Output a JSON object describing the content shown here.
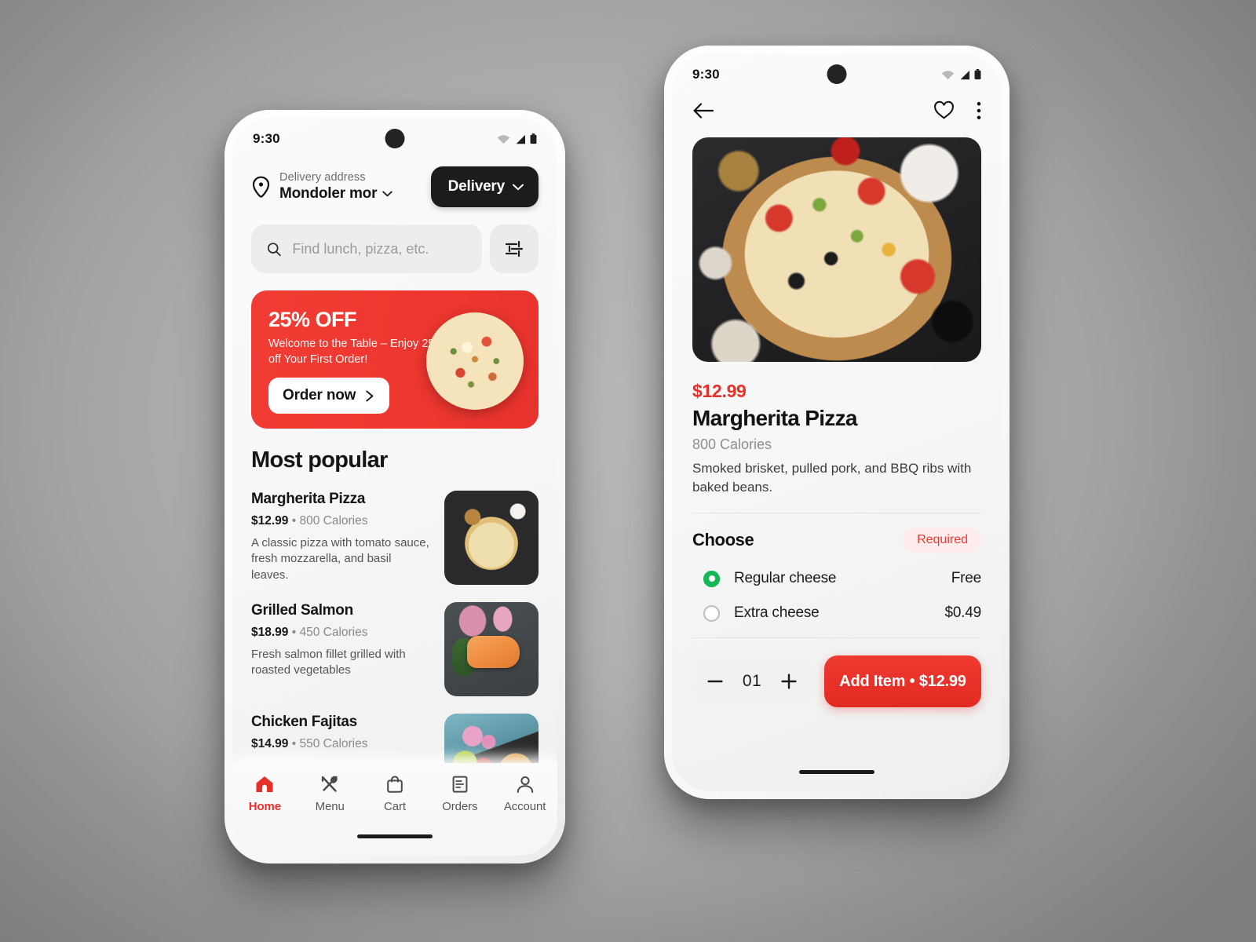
{
  "accent": {
    "red": "#E8302A",
    "red_bright": "#F03D34",
    "green": "#14B855",
    "dark": "#1C1C1C"
  },
  "status_bar": {
    "time": "9:30"
  },
  "home_screen": {
    "delivery": {
      "address_label": "Delivery address",
      "address_value": "Mondoler mor",
      "mode_button": "Delivery"
    },
    "search": {
      "placeholder": "Find lunch, pizza, etc.",
      "value": ""
    },
    "promo": {
      "headline": "25% OFF",
      "subtext": "Welcome to the Table – Enjoy 25% off Your First Order!",
      "cta": "Order now"
    },
    "section_title": "Most popular",
    "items": [
      {
        "name": "Margherita Pizza",
        "price": "$12.99",
        "calories": "800 Calories",
        "description": "A classic pizza with tomato sauce, fresh mozzarella, and basil leaves."
      },
      {
        "name": "Grilled Salmon",
        "price": "$18.99",
        "calories": "450 Calories",
        "description": "Fresh salmon fillet grilled with roasted vegetables"
      },
      {
        "name": "Chicken Fajitas",
        "price": "$14.99",
        "calories": "550 Calories",
        "description": ""
      }
    ],
    "nav": [
      {
        "label": "Home",
        "icon": "home-icon",
        "active": true
      },
      {
        "label": "Menu",
        "icon": "cutlery-icon",
        "active": false
      },
      {
        "label": "Cart",
        "icon": "bag-icon",
        "active": false
      },
      {
        "label": "Orders",
        "icon": "receipt-icon",
        "active": false
      },
      {
        "label": "Account",
        "icon": "person-icon",
        "active": false
      }
    ]
  },
  "detail_screen": {
    "price": "$12.99",
    "title": "Margherita Pizza",
    "calories": "800 Calories",
    "description": "Smoked brisket, pulled pork, and BBQ ribs with baked beans.",
    "choose": {
      "title": "Choose",
      "badge": "Required",
      "options": [
        {
          "label": "Regular cheese",
          "price": "Free",
          "selected": true
        },
        {
          "label": "Extra cheese",
          "price": "$0.49",
          "selected": false
        }
      ]
    },
    "quantity": "01",
    "add_button": "Add Item • $12.99"
  }
}
